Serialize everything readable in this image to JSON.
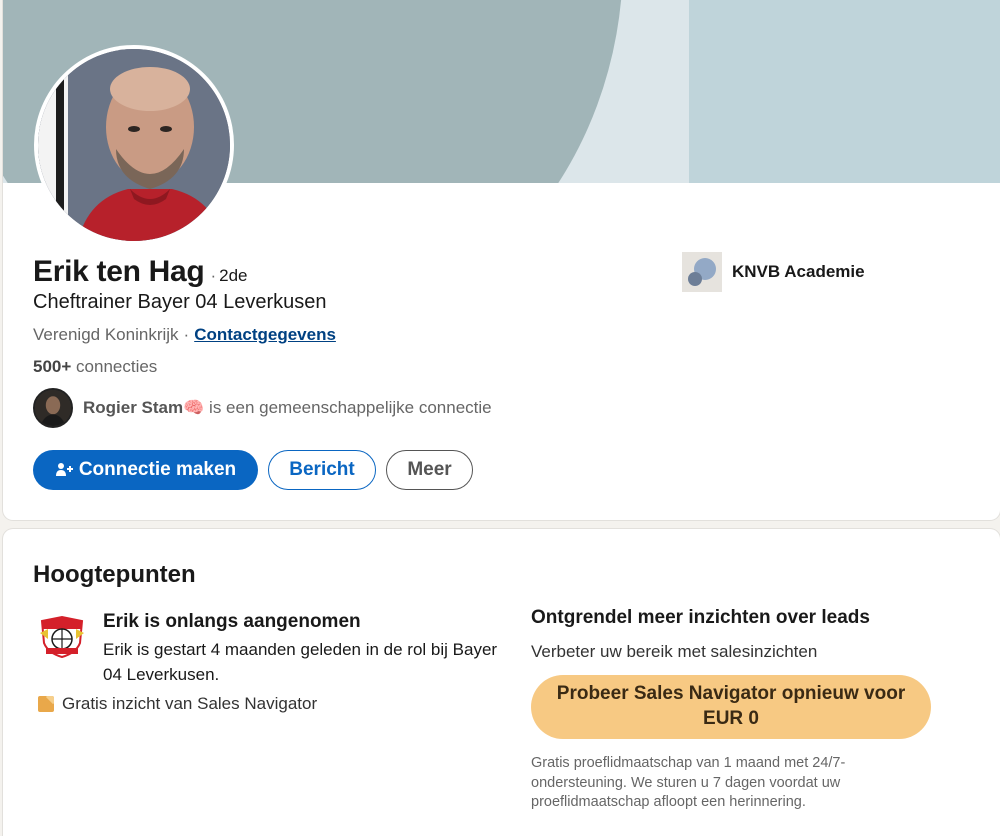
{
  "profile": {
    "name": "Erik ten Hag",
    "degree": "2de",
    "headline": "Cheftrainer Bayer 04 Leverkusen",
    "location": "Verenigd Koninkrijk",
    "contact_link": "Contactgegevens",
    "connections_count": "500+",
    "connections_label": "connecties",
    "mutual": {
      "name": "Rogier Stam",
      "emoji": "🧠",
      "text": "is een gemeenschappelijke connectie"
    },
    "actions": {
      "connect": "Connectie maken",
      "message": "Bericht",
      "more": "Meer"
    },
    "company": "KNVB Academie"
  },
  "highlights": {
    "title": "Hoogtepunten",
    "hired": {
      "heading": "Erik is onlangs aangenomen",
      "body": "Erik is gestart 4 maanden geleden in de rol bij Bayer 04 Leverkusen.",
      "insight": "Gratis inzicht van Sales Navigator"
    },
    "sales_nav": {
      "heading": "Ontgrendel meer inzichten over leads",
      "subheading": "Verbeter uw bereik met salesinzichten",
      "cta": "Probeer Sales Navigator opnieuw voor EUR 0",
      "fineprint": "Gratis proeflidmaatschap van 1 maand met 24/7-ondersteuning. We sturen u 7 dagen voordat uw proeflidmaatschap afloopt een herinnering."
    }
  },
  "colors": {
    "primary": "#0a66c2",
    "cta_gold": "#f7c983",
    "banner_shape": "#a1b5b8",
    "banner_bg": "#dce6ea"
  }
}
